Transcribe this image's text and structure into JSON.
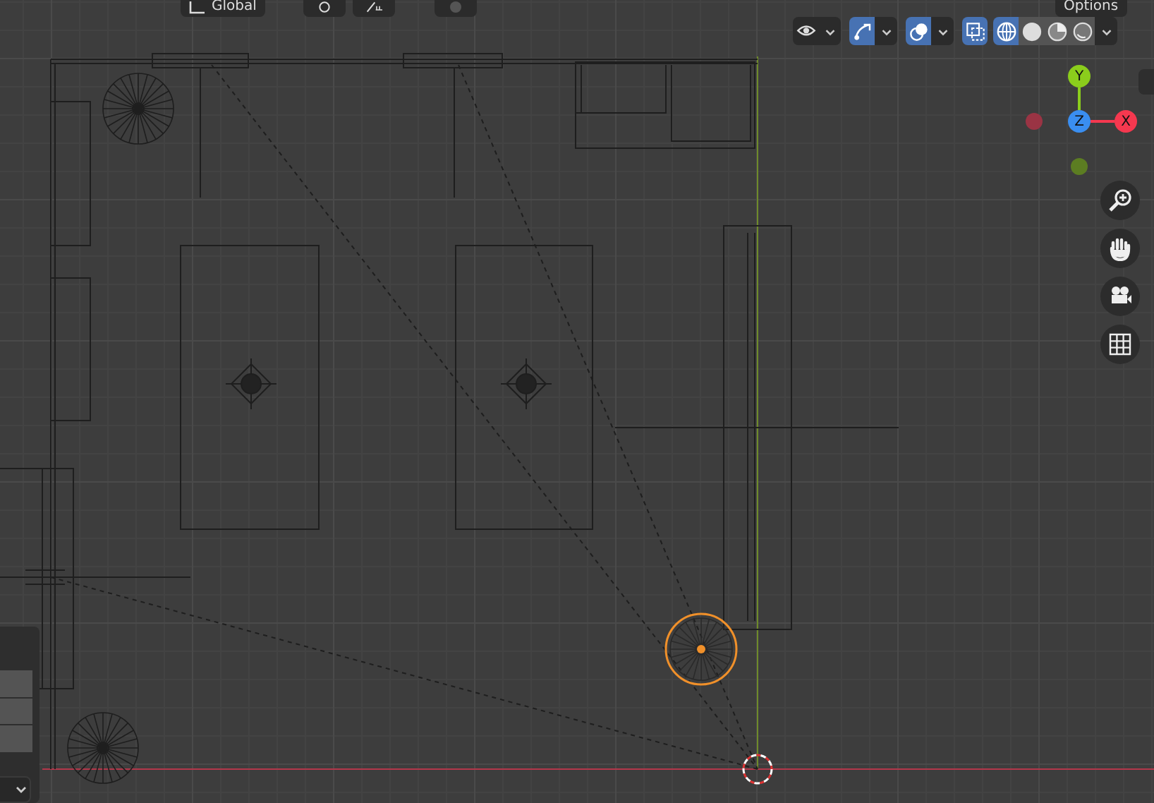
{
  "header": {
    "orientation": "Global",
    "options": "Options",
    "tools": [
      {
        "kind": "pivot",
        "selected": false
      },
      {
        "kind": "snap",
        "selected": false
      },
      {
        "kind": "proportional",
        "selected": false
      }
    ]
  },
  "toolbar": [
    {
      "kind": "visibility",
      "selected": false
    },
    {
      "kind": "gizmo",
      "selected": true
    },
    {
      "kind": "overlay",
      "selected": true
    },
    {
      "kind": "xray",
      "selected": true
    }
  ],
  "shading": [
    {
      "kind": "wireframe",
      "selected": true
    },
    {
      "kind": "solid",
      "selected": false
    },
    {
      "kind": "material",
      "selected": false
    },
    {
      "kind": "rendered",
      "selected": false
    }
  ],
  "gizmo": {
    "axes": [
      {
        "kind": "y",
        "label": "Y",
        "color": "#8bcd1c"
      },
      {
        "kind": "z",
        "label": "Z",
        "color": "#3a8ef0"
      },
      {
        "kind": "x",
        "label": "X",
        "color": "#f5384f"
      }
    ]
  },
  "navigation": [
    {
      "kind": "zoom"
    },
    {
      "kind": "pan"
    },
    {
      "kind": "camera"
    },
    {
      "kind": "grid"
    }
  ]
}
